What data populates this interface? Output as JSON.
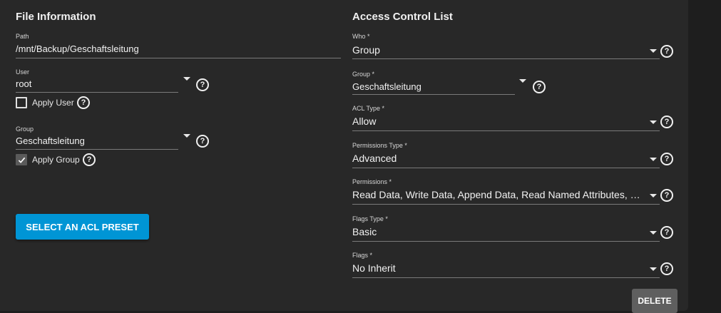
{
  "file_info": {
    "title": "File Information",
    "path": {
      "label": "Path",
      "value": "/mnt/Backup/Geschaftsleitung"
    },
    "user": {
      "label": "User",
      "value": "root",
      "apply_label": "Apply User",
      "apply_checked": false
    },
    "group": {
      "label": "Group",
      "value": "Geschaftsleitung",
      "apply_label": "Apply Group",
      "apply_checked": true
    },
    "preset_button": "SELECT AN ACL PRESET"
  },
  "acl": {
    "title": "Access Control List",
    "who": {
      "label": "Who *",
      "value": "Group"
    },
    "group": {
      "label": "Group *",
      "value": "Geschaftsleitung"
    },
    "acl_type": {
      "label": "ACL Type *",
      "value": "Allow"
    },
    "permissions_type": {
      "label": "Permissions Type *",
      "value": "Advanced"
    },
    "permissions": {
      "label": "Permissions *",
      "value": "Read Data, Write Data, Append Data, Read Named Attributes, Wri…"
    },
    "flags_type": {
      "label": "Flags Type *",
      "value": "Basic"
    },
    "flags": {
      "label": "Flags *",
      "value": "No Inherit"
    },
    "delete_button": "DELETE"
  },
  "icons": {
    "help": "help-circle-icon",
    "dropdown": "chevron-down-icon",
    "check": "check-icon"
  },
  "colors": {
    "primary": "#0095d5",
    "card": "#282828",
    "background": "#1e1e1e"
  }
}
